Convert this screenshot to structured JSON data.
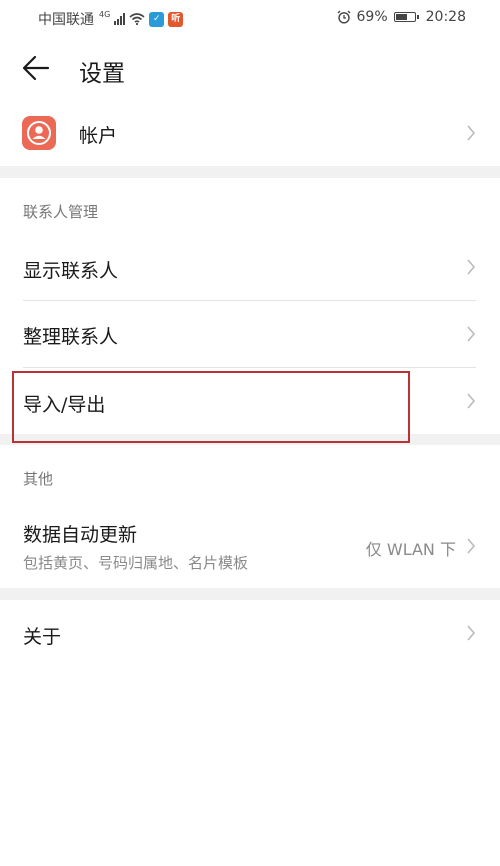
{
  "status_bar": {
    "carrier": "中国联通",
    "network_type": "4G",
    "badges": [
      {
        "text": "✓",
        "color": "#2b9ad8"
      },
      {
        "text": "听",
        "color": "#e2572c"
      }
    ],
    "alarm_icon": "alarm-clock-icon",
    "battery_percent": "69%",
    "battery_level": 0.69,
    "time": "20:28"
  },
  "header": {
    "back_icon": "arrow-left-icon",
    "title": "设置"
  },
  "account": {
    "label": "帐户",
    "icon": "account-person-icon",
    "icon_color": "#ec6a55"
  },
  "contacts_section": {
    "header": "联系人管理",
    "items": [
      {
        "label": "显示联系人"
      },
      {
        "label": "整理联系人"
      },
      {
        "label": "导入/导出"
      }
    ]
  },
  "other_section": {
    "header": "其他",
    "auto_update": {
      "label": "数据自动更新",
      "subtitle": "包括黄页、号码归属地、名片模板",
      "value": "仅 WLAN 下"
    }
  },
  "about": {
    "label": "关于"
  },
  "highlight_color": "#b93236"
}
